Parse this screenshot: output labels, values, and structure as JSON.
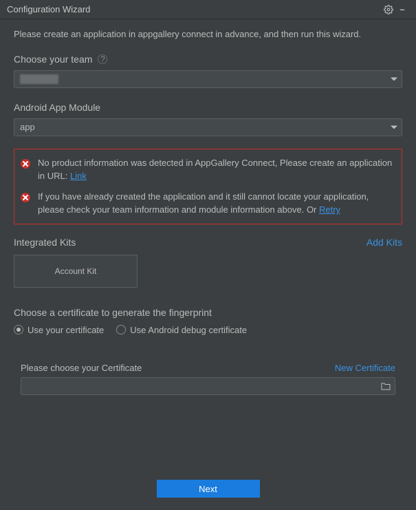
{
  "window": {
    "title": "Configuration Wizard"
  },
  "intro": "Please create an application in appgallery connect in advance, and then run this wizard.",
  "team": {
    "label": "Choose your team",
    "value": ""
  },
  "module": {
    "label": "Android App Module",
    "value": "app"
  },
  "errors": {
    "item1_prefix": "No product information was detected in AppGallery Connect, Please create an application in URL: ",
    "item1_link": "Link",
    "item2_prefix": "If you have already created the application and it still cannot locate your application, please check your team information and module information above. Or ",
    "item2_link": "Retry"
  },
  "kits": {
    "label": "Integrated Kits",
    "add_label": "Add Kits",
    "chips": [
      "Account Kit"
    ]
  },
  "cert": {
    "section_label": "Choose a certificate to generate the fingerprint",
    "options": {
      "use_your": "Use your certificate",
      "use_debug": "Use Android debug certificate"
    },
    "selected": "use_your",
    "choose_label": "Please choose your Certificate",
    "new_label": "New Certificate",
    "path": ""
  },
  "footer": {
    "next_label": "Next"
  }
}
